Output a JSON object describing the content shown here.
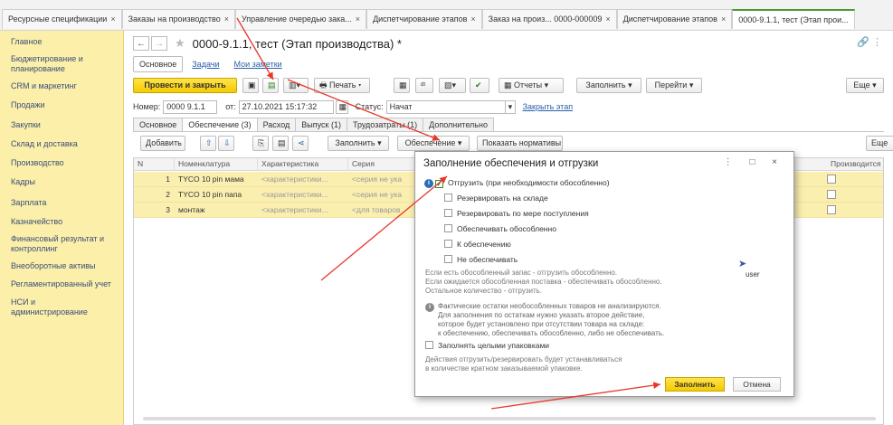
{
  "tabs": [
    {
      "label": "Ресурсные спецификации"
    },
    {
      "label": "Заказы на производство"
    },
    {
      "label": "Управление очередью зака..."
    },
    {
      "label": "Диспетчирование этапов"
    },
    {
      "label": "Заказ на произ... 0000-000009"
    },
    {
      "label": "Диспетчирование этапов"
    },
    {
      "label": "0000-9.1.1, тест (Этап прои..."
    }
  ],
  "sidebar": {
    "items": [
      {
        "label": "Главное"
      },
      {
        "label": "Бюджетирование и планирование"
      },
      {
        "label": "CRM и маркетинг"
      },
      {
        "label": "Продажи"
      },
      {
        "label": "Закупки"
      },
      {
        "label": "Склад и доставка"
      },
      {
        "label": "Производство"
      },
      {
        "label": "Кадры"
      },
      {
        "label": "Зарплата"
      },
      {
        "label": "Казначейство"
      },
      {
        "label": "Финансовый результат и контроллинг"
      },
      {
        "label": "Внеоборотные активы"
      },
      {
        "label": "Регламентированный учет"
      },
      {
        "label": "НСИ и администрирование"
      }
    ]
  },
  "header": {
    "title": "0000-9.1.1, тест (Этап производства) *",
    "subnav": {
      "main": "Основное",
      "tasks": "Задачи",
      "notes": "Мои заметки"
    }
  },
  "toolbar": {
    "post_close": "Провести и закрыть",
    "print": "Печать",
    "reports": "Отчеты",
    "fill": "Заполнить",
    "goto": "Перейти",
    "more": "Еще"
  },
  "fields": {
    "number_label": "Номер:",
    "number_value": "0000 9.1.1",
    "date_label": "от:",
    "date_value": "27.10.2021 15:17:32",
    "status_label": "Статус:",
    "status_value": "Начат",
    "close_stage": "Закрыть этап"
  },
  "doc_tabs": [
    {
      "label": "Основное"
    },
    {
      "label": "Обеспечение (3)"
    },
    {
      "label": "Расход"
    },
    {
      "label": "Выпуск (1)"
    },
    {
      "label": "Трудозатраты (1)"
    },
    {
      "label": "Дополнительно"
    }
  ],
  "toolbar2": {
    "add": "Добавить",
    "fill": "Заполнить",
    "supply": "Обеспечение",
    "show_norms": "Показать нормативы",
    "more": "Еще"
  },
  "table": {
    "columns": {
      "n": "N",
      "nom": "Номенклатура",
      "char": "Характеристика",
      "series": "Серия",
      "prod": "Производится"
    },
    "rows": [
      {
        "n": "1",
        "nom": "TYCO 10 pin мама",
        "char": "<характеристики...",
        "series": "<серия не ука"
      },
      {
        "n": "2",
        "nom": "TYCO 10 pin папа",
        "char": "<характеристики...",
        "series": "<серия не ука"
      },
      {
        "n": "3",
        "nom": "монтаж",
        "char": "<характеристики...",
        "series": "<для товаров"
      }
    ]
  },
  "modal": {
    "title": "Заполнение обеспечения и отгрузки",
    "options": [
      {
        "label": "Отгрузить (при необходимости обособленно)",
        "checked": true
      },
      {
        "label": "Резервировать на складе",
        "checked": false
      },
      {
        "label": "Резервировать по мере поступления",
        "checked": false
      },
      {
        "label": "Обеспечивать обособленно",
        "checked": false
      },
      {
        "label": "К обеспечению",
        "checked": false
      },
      {
        "label": "Не обеспечивать",
        "checked": false
      }
    ],
    "note1": [
      "Если есть обособленный запас - отгрузить обособленно.",
      "Если ожидается обособленная поставка - обеспечивать обособленно.",
      "Остальное количество - отгрузить."
    ],
    "user_label": "user",
    "note2": [
      "Фактические остатки необособленных товаров не анализируются.",
      "Для заполнения по остаткам нужно указать второе действие,",
      "которое будет установлено при отсутствии товара на складе:",
      "к обеспечению, обеспечивать обособленно, либо не обеспечивать."
    ],
    "pack_label": "Заполнять целыми упаковками",
    "note3": [
      "Действия отгрузить/резервировать будет устанавливаться",
      "в количестве кратном заказываемой упаковке."
    ],
    "fill_button": "Заполнить",
    "cancel_button": "Отмена"
  },
  "colors": {
    "sidebar_bg": "#fbefa9",
    "primary_button": "#f5c900",
    "arrow": "#e8372c",
    "row_highlight": "#fbefb0"
  }
}
